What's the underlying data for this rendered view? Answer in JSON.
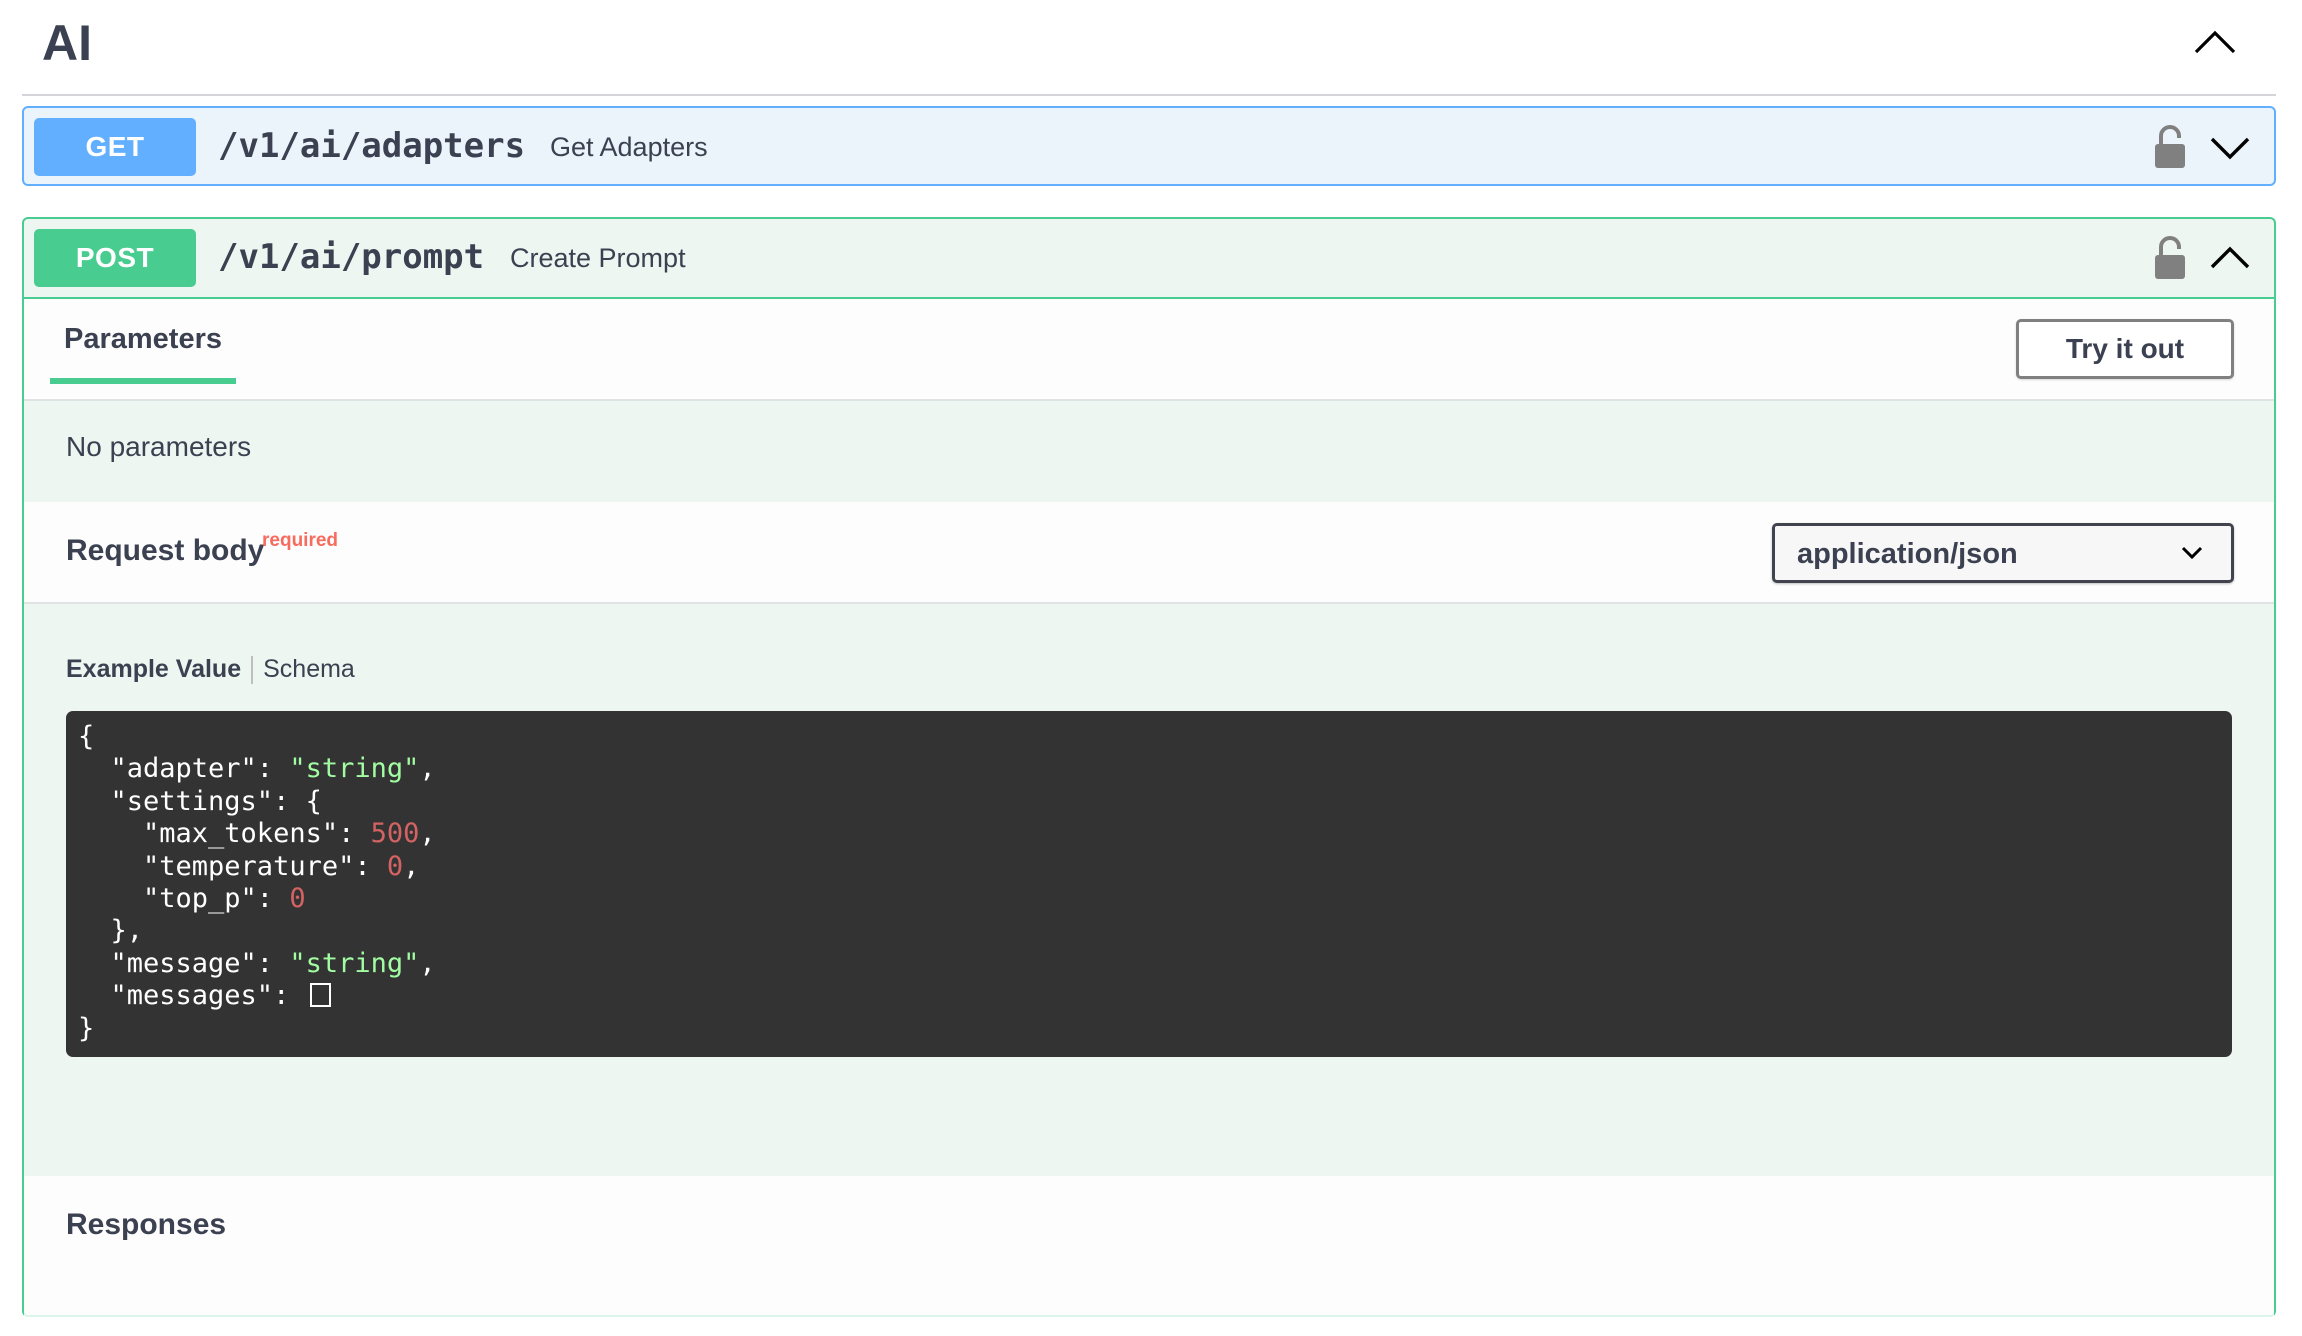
{
  "tag": {
    "title": "AI",
    "toggle_icon": "chevron-up-icon"
  },
  "operations": [
    {
      "method": "GET",
      "path": "/v1/ai/adapters",
      "summary": "Get Adapters",
      "expanded": false,
      "color": "#61affe"
    },
    {
      "method": "POST",
      "path": "/v1/ai/prompt",
      "summary": "Create Prompt",
      "expanded": true,
      "color": "#49cc90"
    }
  ],
  "post_detail": {
    "parameters_tab": "Parameters",
    "try_it_out": "Try it out",
    "no_parameters": "No parameters",
    "request_body_label": "Request body",
    "required_label": "required",
    "content_type": "application/json",
    "example_value_tab": "Example Value",
    "schema_tab": "Schema",
    "example_json": {
      "adapter": "string",
      "settings": {
        "max_tokens": 500,
        "temperature": 0,
        "top_p": 0
      },
      "message": "string",
      "messages": []
    },
    "responses_label": "Responses"
  },
  "colors": {
    "get": "#61affe",
    "post": "#49cc90",
    "required": "#f76c5e",
    "code_bg": "#333333",
    "code_string": "#a2fca2",
    "code_number": "#d36363"
  }
}
